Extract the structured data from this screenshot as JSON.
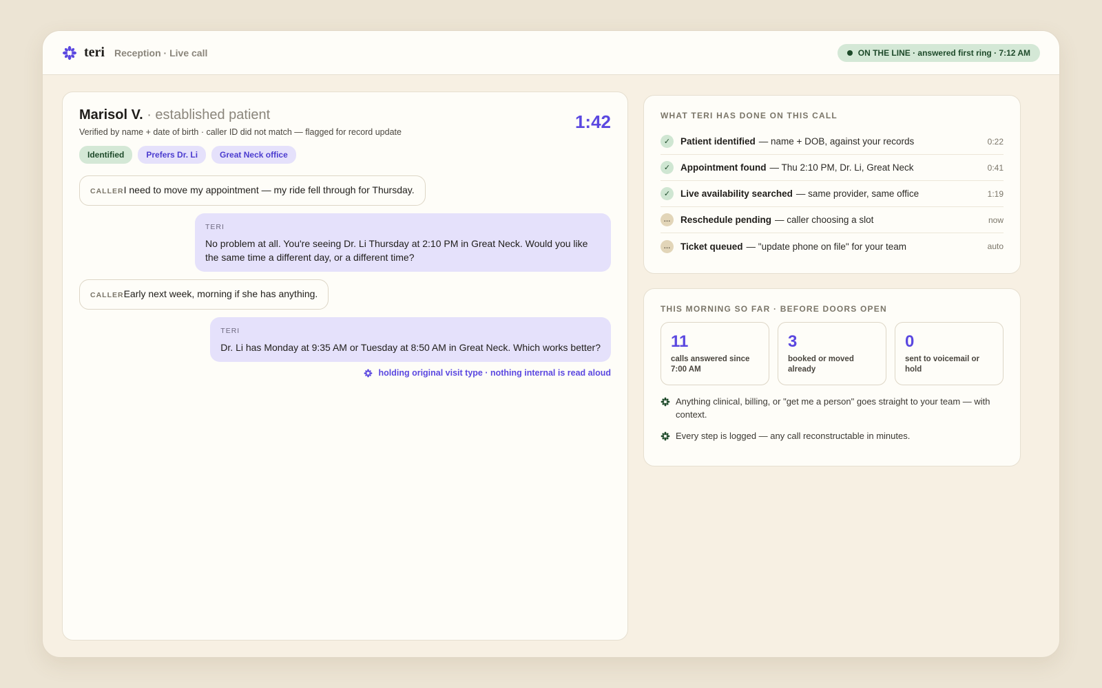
{
  "app": {
    "brand_name": "teri",
    "context": "Reception · Live call",
    "status": "ON THE LINE · answered first ring · 7:12 AM",
    "accent_color": "#5b48e0",
    "status_color": "#1e4a2a"
  },
  "call": {
    "caller_name": "Marisol V.",
    "caller_sub": " · established patient",
    "verification": "Verified by name + date of birth · caller ID did not match — flagged for record update",
    "timer": "1:42",
    "tags": [
      {
        "label": "Identified",
        "style": "green"
      },
      {
        "label": "Prefers Dr. Li",
        "style": "purple"
      },
      {
        "label": "Great Neck office",
        "style": "purple"
      }
    ],
    "transcript": [
      {
        "speaker": "CALLER",
        "text": "I need to move my appointment — my ride fell through for Thursday."
      },
      {
        "speaker": "TERI",
        "text": "No problem at all. You're seeing Dr. Li Thursday at 2:10 PM in Great Neck. Would you like the same time a different day, or a different time?"
      },
      {
        "speaker": "CALLER",
        "text": "Early next week, morning if she has anything."
      },
      {
        "speaker": "TERI",
        "text": "Dr. Li has Monday at 9:35 AM or Tuesday at 8:50 AM in Great Neck. Which works better?"
      }
    ],
    "hold_note": "holding original visit type · nothing internal is read aloud"
  },
  "actions": {
    "title": "WHAT TERI HAS DONE ON THIS CALL",
    "steps": [
      {
        "status": "done",
        "icon": "✓",
        "title": "Patient identified",
        "detail": "— name + DOB, against your records",
        "time": "0:22"
      },
      {
        "status": "done",
        "icon": "✓",
        "title": "Appointment found",
        "detail": "— Thu 2:10 PM, Dr. Li, Great Neck",
        "time": "0:41"
      },
      {
        "status": "done",
        "icon": "✓",
        "title": "Live availability searched",
        "detail": "— same provider, same office",
        "time": "1:19"
      },
      {
        "status": "pending",
        "icon": "…",
        "title": "Reschedule pending",
        "detail": "— caller choosing a slot",
        "time": "now"
      },
      {
        "status": "pending",
        "icon": "…",
        "title": "Ticket queued",
        "detail": "— \"update phone on file\" for your team",
        "time": "auto"
      }
    ]
  },
  "morning": {
    "title": "THIS MORNING SO FAR · BEFORE DOORS OPEN",
    "stats": [
      {
        "value": "11",
        "label": "calls answered since 7:00 AM"
      },
      {
        "value": "3",
        "label": "booked or moved already"
      },
      {
        "value": "0",
        "label": "sent to voicemail or hold"
      }
    ],
    "notes": [
      "Anything clinical, billing, or \"get me a person\" goes straight to your team — with context.",
      "Every step is logged — any call reconstructable in minutes."
    ]
  }
}
